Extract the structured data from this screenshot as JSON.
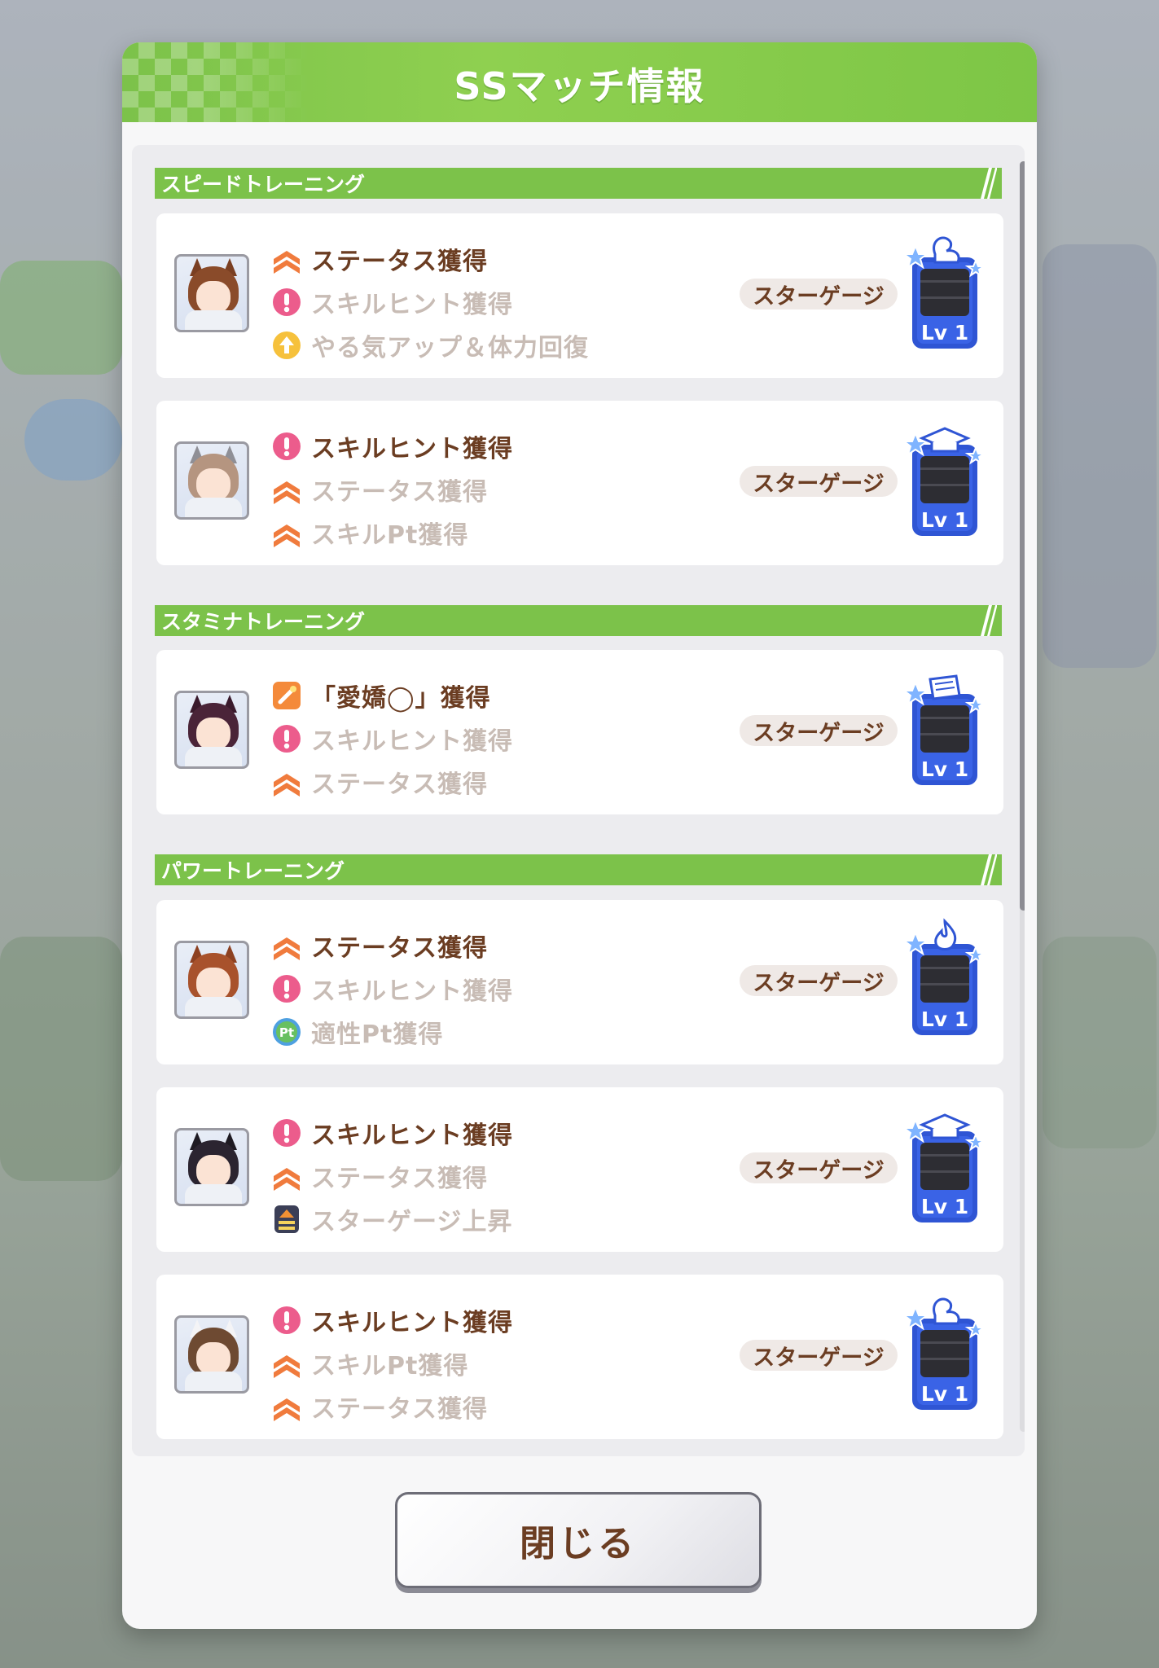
{
  "dialog": {
    "title": "SSマッチ情報",
    "close_label": "閉じる"
  },
  "sections": [
    {
      "title": "スピードトレーニング",
      "cards": [
        {
          "character": "brown-hair-uma",
          "effects": [
            {
              "icon": "status-up-icon",
              "label": "ステータス獲得",
              "active": true
            },
            {
              "icon": "skill-hint-icon",
              "label": "スキルヒント獲得",
              "active": false
            },
            {
              "icon": "motivation-up-icon",
              "label": "やる気アップ＆体力回復",
              "active": false
            }
          ],
          "gauge_label": "スターゲージ",
          "badge": {
            "icon": "muscle-arm-icon",
            "level": "Lv 1"
          }
        },
        {
          "character": "beanie-uma",
          "effects": [
            {
              "icon": "skill-hint-icon",
              "label": "スキルヒント獲得",
              "active": true
            },
            {
              "icon": "status-up-icon",
              "label": "ステータス獲得",
              "active": false
            },
            {
              "icon": "status-up-icon",
              "label": "スキルPt獲得",
              "active": false
            }
          ],
          "gauge_label": "スターゲージ",
          "badge": {
            "icon": "graduation-cap-icon",
            "level": "Lv 1"
          }
        }
      ]
    },
    {
      "title": "スタミナトレーニング",
      "cards": [
        {
          "character": "dark-hair-uma",
          "effects": [
            {
              "icon": "condition-icon",
              "label": "「愛嬌◯」獲得",
              "active": true
            },
            {
              "icon": "skill-hint-icon",
              "label": "スキルヒント獲得",
              "active": false
            },
            {
              "icon": "status-up-icon",
              "label": "ステータス獲得",
              "active": false
            }
          ],
          "gauge_label": "スターゲージ",
          "badge": {
            "icon": "book-icon",
            "level": "Lv 1"
          }
        }
      ]
    },
    {
      "title": "パワートレーニング",
      "cards": [
        {
          "character": "chestnut-hair-uma",
          "effects": [
            {
              "icon": "status-up-icon",
              "label": "ステータス獲得",
              "active": true
            },
            {
              "icon": "skill-hint-icon",
              "label": "スキルヒント獲得",
              "active": false
            },
            {
              "icon": "aptitude-pt-icon",
              "label": "適性Pt獲得",
              "active": false
            }
          ],
          "gauge_label": "スターゲージ",
          "badge": {
            "icon": "flame-icon",
            "level": "Lv 1"
          }
        },
        {
          "character": "black-hair-uma",
          "effects": [
            {
              "icon": "skill-hint-icon",
              "label": "スキルヒント獲得",
              "active": true
            },
            {
              "icon": "status-up-icon",
              "label": "ステータス獲得",
              "active": false
            },
            {
              "icon": "star-gauge-up-icon",
              "label": "スターゲージ上昇",
              "active": false
            }
          ],
          "gauge_label": "スターゲージ",
          "badge": {
            "icon": "graduation-cap-icon",
            "level": "Lv 1"
          }
        },
        {
          "character": "white-cap-uma",
          "effects": [
            {
              "icon": "skill-hint-icon",
              "label": "スキルヒント獲得",
              "active": true
            },
            {
              "icon": "status-up-icon",
              "label": "スキルPt獲得",
              "active": false
            },
            {
              "icon": "status-up-icon",
              "label": "ステータス獲得",
              "active": false
            }
          ],
          "gauge_label": "スターゲージ",
          "badge": {
            "icon": "muscle-arm-icon",
            "level": "Lv 1"
          }
        }
      ]
    }
  ],
  "colors": {
    "accent_green": "#7cc24a",
    "active_text": "#6b3d22",
    "inactive_text": "#c8bcb5",
    "badge_blue": "#2f55d4"
  }
}
